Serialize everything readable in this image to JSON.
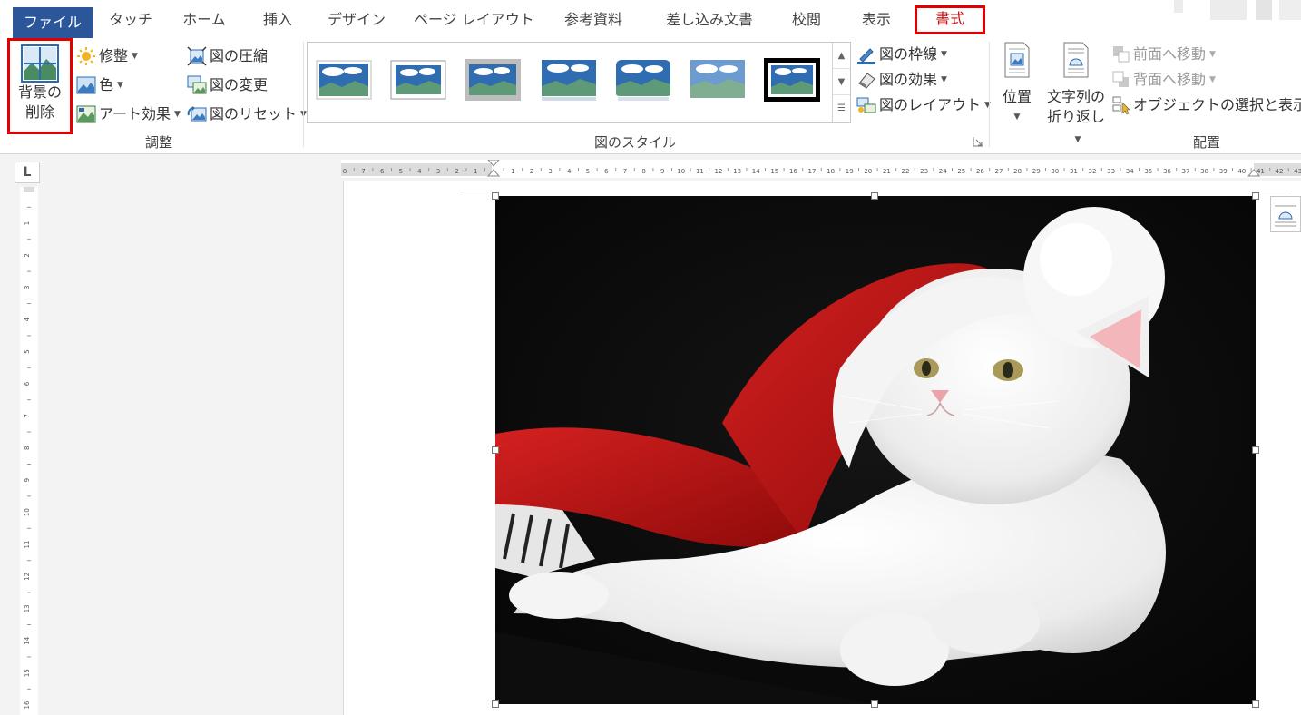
{
  "tabs": {
    "file": "ファイル",
    "touch": "タッチ",
    "home": "ホーム",
    "insert": "挿入",
    "design": "デザイン",
    "page_layout": "ページ レイアウト",
    "references": "参考資料",
    "mailings": "差し込み文書",
    "review": "校閲",
    "view": "表示",
    "format": "書式"
  },
  "adjust": {
    "remove_bg_line1": "背景の",
    "remove_bg_line2": "削除",
    "corrections": "修整",
    "color": "色",
    "artistic_effects": "アート効果",
    "compress": "図の圧縮",
    "change": "図の変更",
    "reset": "図のリセット",
    "group_label": "調整"
  },
  "styles": {
    "border": "図の枠線",
    "effects": "図の効果",
    "layout": "図のレイアウト",
    "group_label": "図のスタイル"
  },
  "arrange": {
    "position": "位置",
    "wrap_line1": "文字列の",
    "wrap_line2": "折り返し",
    "bring_forward": "前面へ移動",
    "send_backward": "背面へ移動",
    "selection_pane": "オブジェクトの選択と表示",
    "group_label": "配置"
  },
  "ruler": {
    "corner": "L",
    "hticks": [
      "8",
      "7",
      "6",
      "5",
      "4",
      "3",
      "2",
      "1",
      "",
      "1",
      "2",
      "3",
      "4",
      "5",
      "6",
      "7",
      "8",
      "9",
      "10",
      "11",
      "12",
      "13",
      "14",
      "15",
      "16",
      "17",
      "18",
      "19",
      "20",
      "21",
      "22",
      "23",
      "24",
      "25",
      "26",
      "27",
      "28",
      "29",
      "30",
      "31",
      "32",
      "33",
      "34",
      "35",
      "36",
      "37",
      "38",
      "39",
      "40",
      "41",
      "42",
      "43"
    ],
    "vticks": [
      "1",
      "2",
      "3",
      "4",
      "5",
      "6",
      "7",
      "8",
      "9",
      "10",
      "11",
      "12",
      "13",
      "14",
      "15",
      "16"
    ]
  },
  "colors": {
    "accent": "#2b579a",
    "highlight": "#e00000"
  }
}
